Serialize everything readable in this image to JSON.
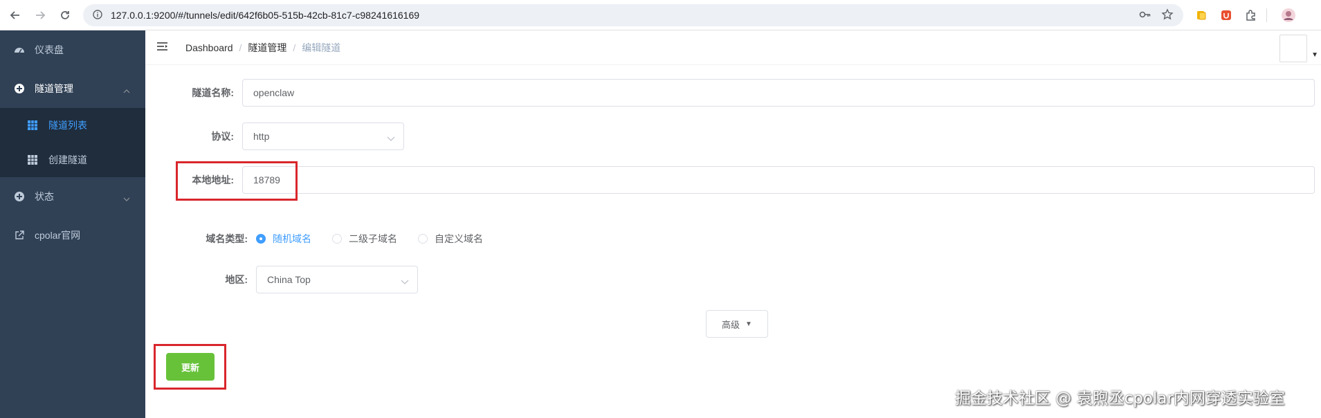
{
  "browser": {
    "url": "127.0.0.1:9200/#/tunnels/edit/642f6b05-515b-42cb-81c7-c98241616169"
  },
  "sidebar": {
    "items": [
      {
        "label": "仪表盘"
      },
      {
        "label": "隧道管理",
        "children": [
          {
            "label": "隧道列表"
          },
          {
            "label": "创建隧道"
          }
        ]
      },
      {
        "label": "状态"
      },
      {
        "label": "cpolar官网"
      }
    ]
  },
  "breadcrumb": [
    "Dashboard",
    "隧道管理",
    "编辑隧道"
  ],
  "form": {
    "name_label": "隧道名称:",
    "name_value": "openclaw",
    "protocol_label": "协议:",
    "protocol_value": "http",
    "local_label": "本地地址:",
    "local_value": "18789",
    "domain_type_label": "域名类型:",
    "domain_options": [
      "随机域名",
      "二级子域名",
      "自定义域名"
    ],
    "region_label": "地区:",
    "region_value": "China Top",
    "advanced_label": "高级",
    "update_label": "更新"
  },
  "colors": {
    "sidebar_bg": "#304156",
    "submenu_bg": "#1f2d3d",
    "active": "#409eff",
    "primary_success": "#67c23a",
    "highlight": "#d9262c"
  },
  "watermark": "掘金技术社区 @ 袁煦丞cpolar内网穿透实验室"
}
